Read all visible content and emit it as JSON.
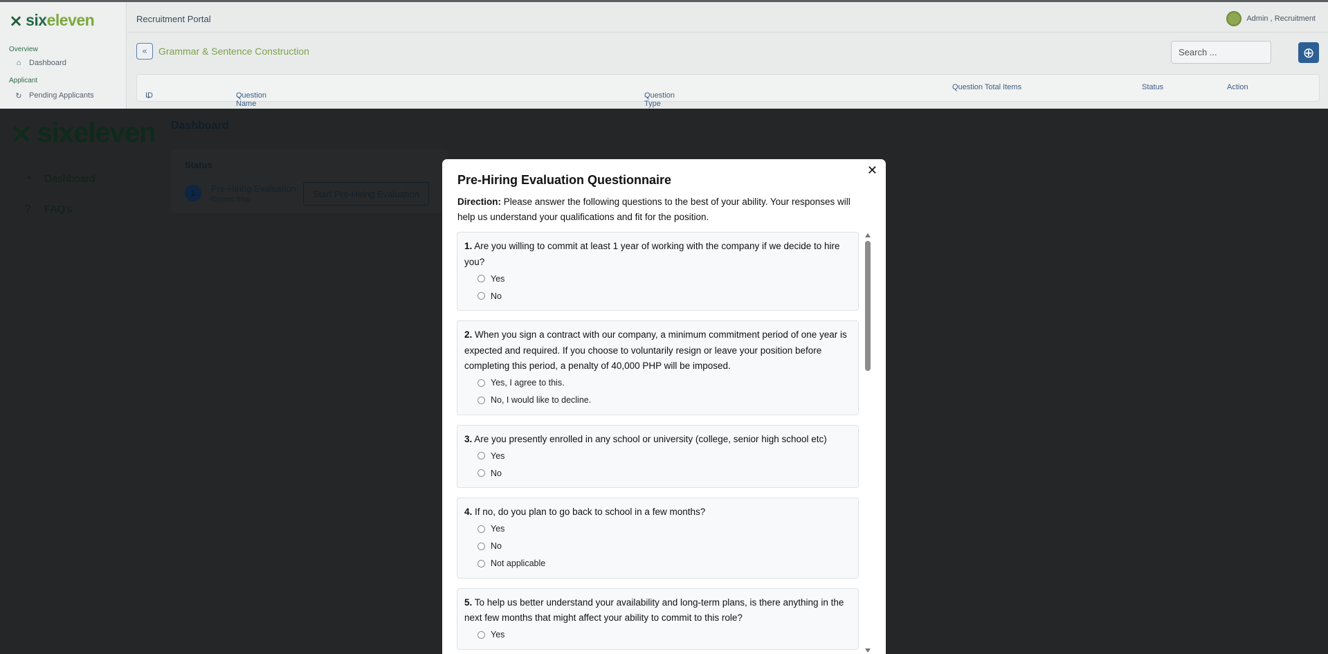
{
  "admin": {
    "logo": {
      "prefix": "six",
      "suffix": "eleven"
    },
    "sidebar": {
      "sections": [
        {
          "label": "Overview",
          "items": [
            {
              "label": "Dashboard",
              "icon": "home-icon"
            }
          ]
        },
        {
          "label": "Applicant",
          "items": [
            {
              "label": "Pending Applicants",
              "icon": "clock-refresh-icon"
            }
          ]
        }
      ]
    },
    "header": {
      "portal_title": "Recruitment Portal",
      "user": "Admin , Recruitment"
    },
    "page": {
      "title": "Grammar & Sentence Construction",
      "search_placeholder": "Search ..."
    },
    "table": {
      "columns": [
        "ID",
        "Question Name",
        "Question Type",
        "Question Total Items",
        "Status",
        "Action"
      ]
    }
  },
  "applicant": {
    "logo": "sixeleven",
    "nav": [
      {
        "label": "Dashboard",
        "icon": "dashboard-icon"
      },
      {
        "label": "FAQ's",
        "icon": "question-icon"
      }
    ],
    "page_title": "Dashboard",
    "status": {
      "label": "Status",
      "step_number": "1",
      "step_name": "Pre-Hiring Evaluation",
      "step_sub": "Current Step",
      "start_button": "Start Pre-Hiring Evaluation"
    }
  },
  "modal": {
    "title": "Pre-Hiring Evaluation Questionnaire",
    "direction_label": "Direction:",
    "direction_text": " Please answer the following questions to the best of your ability. Your responses will help us understand your qualifications and fit for the position.",
    "questions": [
      {
        "number": "1.",
        "text": " Are you willing to commit at least 1 year of working with the company if we decide to hire you?",
        "options": [
          "Yes",
          "No"
        ]
      },
      {
        "number": "2.",
        "text": " When you sign a contract with our company, a minimum commitment period of one year is expected and required. If you choose to voluntarily resign or leave your position before completing this period, a penalty of 40,000 PHP will be imposed.",
        "options": [
          "Yes, I agree to this.",
          "No, I would like to decline."
        ]
      },
      {
        "number": "3.",
        "text": " Are you presently enrolled in any school or university (college, senior high school etc)",
        "options": [
          "Yes",
          "No"
        ]
      },
      {
        "number": "4.",
        "text": " If no, do you plan to go back to school in a few months?",
        "options": [
          "Yes",
          "No",
          "Not applicable"
        ]
      },
      {
        "number": "5.",
        "text": " To help us better understand your availability and long-term plans, is there anything in the next few months that might affect your ability to commit to this role?",
        "options": [
          "Yes"
        ]
      }
    ]
  }
}
